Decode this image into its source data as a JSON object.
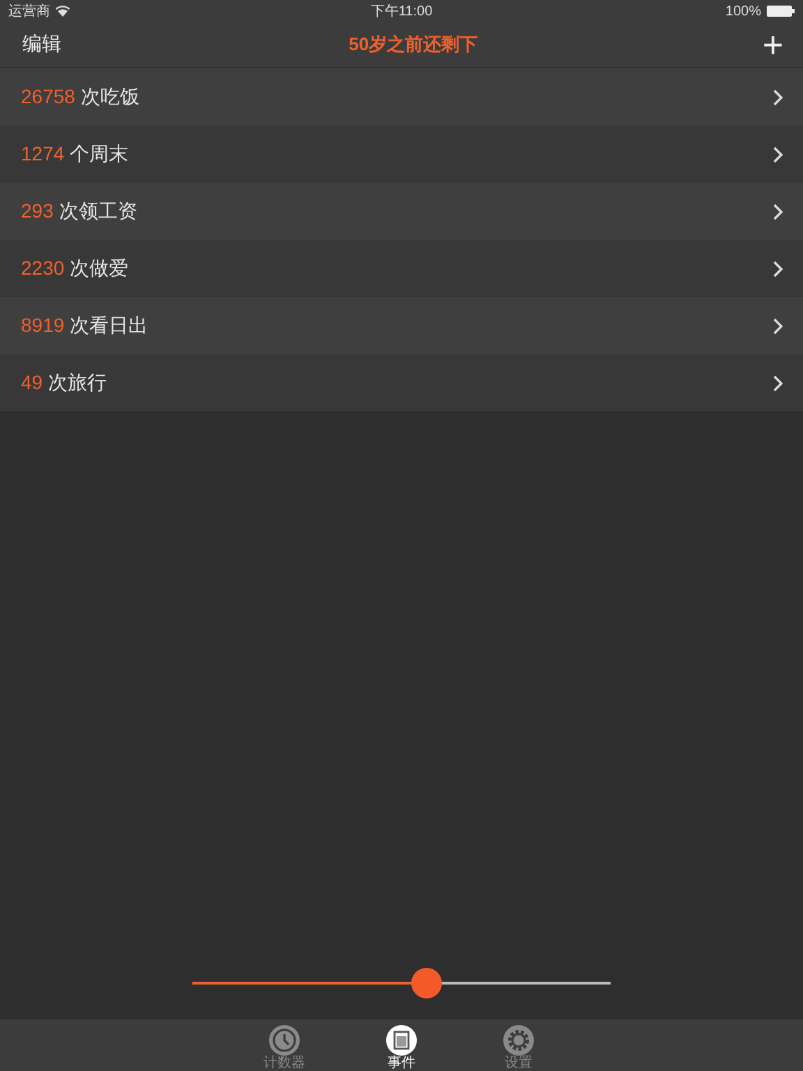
{
  "status_bar": {
    "carrier": "运营商",
    "time": "下午11:00",
    "battery": "100%"
  },
  "nav": {
    "left": "编辑",
    "title": "50岁之前还剩下",
    "right": "+"
  },
  "rows": [
    {
      "count": "26758",
      "label": "次吃饭"
    },
    {
      "count": "1274",
      "label": "个周末"
    },
    {
      "count": "293",
      "label": "次领工资"
    },
    {
      "count": "2230",
      "label": "次做爱"
    },
    {
      "count": "8919",
      "label": "次看日出"
    },
    {
      "count": "49",
      "label": "次旅行"
    }
  ],
  "slider": {
    "level": 0.56
  },
  "tabs": [
    {
      "label": "计数器",
      "kind": "clock",
      "selected": false
    },
    {
      "label": "事件",
      "kind": "list",
      "selected": true
    },
    {
      "label": "设置",
      "kind": "gear",
      "selected": false
    }
  ]
}
